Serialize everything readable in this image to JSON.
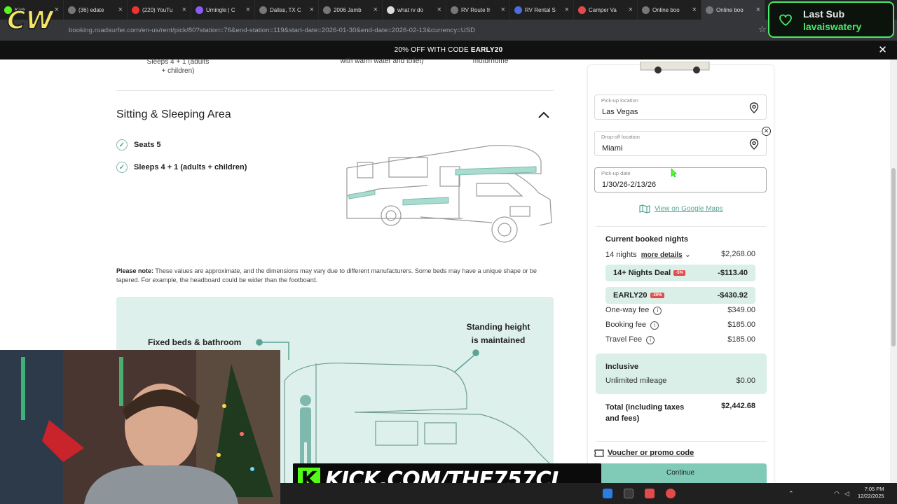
{
  "browser": {
    "tabs": [
      {
        "label": "Kick"
      },
      {
        "label": "(36) edate"
      },
      {
        "label": "(220) YouTu"
      },
      {
        "label": "Umingle | C"
      },
      {
        "label": "Dallas, TX C"
      },
      {
        "label": "2006 Jamb"
      },
      {
        "label": "what rv do"
      },
      {
        "label": "RV Route fr"
      },
      {
        "label": "RV Rental S"
      },
      {
        "label": "Camper Va"
      },
      {
        "label": "Online boo"
      },
      {
        "label": "Online boo"
      }
    ],
    "new_tab": "+",
    "url": "booking.roadsurfer.com/en-us/rent/pick/80?station=76&end-station=119&start-date=2026-01-30&end-date=2026-02-13&currency=USD"
  },
  "promo": {
    "text": "20% OFF WITH CODE ",
    "code": "EARLY20",
    "close": "✕"
  },
  "top_specs": {
    "sleeps": "Sleeps 4 + 1 (adults + children)",
    "bath": "with warm water and toilet)",
    "type": "motorhome"
  },
  "section": {
    "title": "Sitting & Sleeping Area",
    "features": [
      "Seats 5",
      "Sleeps 4 + 1 (adults + children)"
    ]
  },
  "note": {
    "label": "Please note:",
    "text": " These values are approximate, and the dimensions may vary due to different manufacturers. Some beds may have a unique shape or be tapered. For example, the headboard could be wider than the footboard."
  },
  "diagram": {
    "fixed_beds": "Fixed beds & bathroom",
    "standing_line1": "Standing height",
    "standing_line2": "is maintained"
  },
  "booking": {
    "pickup_label": "Pick-up location",
    "pickup_value": "Las Vegas",
    "dropoff_label": "Drop-off location",
    "dropoff_value": "Miami",
    "date_label": "Pick-up date",
    "date_value": "1/30/26-2/13/26",
    "maps_link": "View on Google Maps",
    "nights_title": "Current booked nights",
    "nights_text": "14 nights",
    "more_details": "more details",
    "nights_amount": "$2,268.00",
    "deal1_label": "14+ Nights Deal",
    "deal1_badge": "-5%",
    "deal1_amount": "-$113.40",
    "deal2_label": "EARLY20",
    "deal2_badge": "-20%",
    "deal2_amount": "-$430.92",
    "fees": [
      {
        "label": "One-way fee",
        "amount": "$349.00"
      },
      {
        "label": "Booking fee",
        "amount": "$185.00"
      },
      {
        "label": "Travel Fee",
        "amount": "$185.00"
      }
    ],
    "inclusive_title": "Inclusive",
    "mileage_label": "Unlimited mileage",
    "mileage_amount": "$0.00",
    "total_label": "Total (including taxes and fees)",
    "total_amount": "$2,442.68",
    "voucher": "Voucher or promo code",
    "continue": "Continue"
  },
  "overlay": {
    "sub_line1": "Last Sub",
    "sub_line2": "lavaiswatery",
    "kick_k": "K",
    "kick_text": "KICK.COM/THE757CJ",
    "accent": "#53fc18",
    "brand_teal": "#5aa395"
  },
  "taskbar": {
    "time": "7:05 PM",
    "date": "12/22/2025"
  }
}
